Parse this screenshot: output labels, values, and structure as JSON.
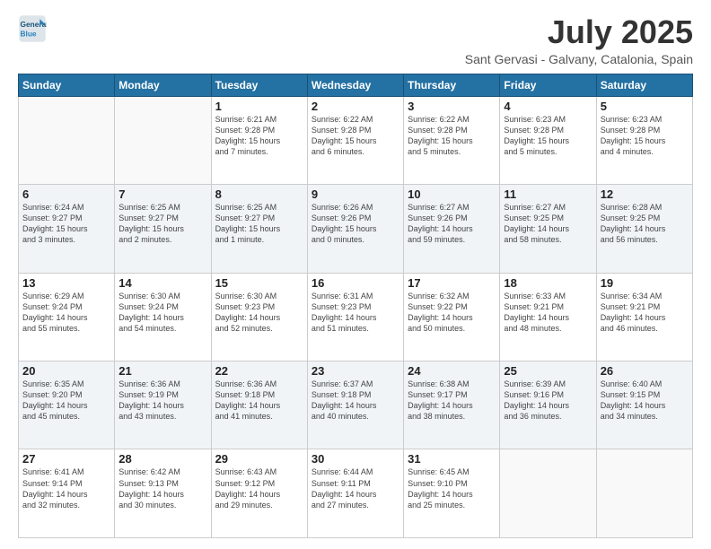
{
  "header": {
    "logo_line1": "General",
    "logo_line2": "Blue",
    "month_title": "July 2025",
    "location": "Sant Gervasi - Galvany, Catalonia, Spain"
  },
  "days_of_week": [
    "Sunday",
    "Monday",
    "Tuesday",
    "Wednesday",
    "Thursday",
    "Friday",
    "Saturday"
  ],
  "weeks": [
    [
      {
        "day": "",
        "info": ""
      },
      {
        "day": "",
        "info": ""
      },
      {
        "day": "1",
        "info": "Sunrise: 6:21 AM\nSunset: 9:28 PM\nDaylight: 15 hours\nand 7 minutes."
      },
      {
        "day": "2",
        "info": "Sunrise: 6:22 AM\nSunset: 9:28 PM\nDaylight: 15 hours\nand 6 minutes."
      },
      {
        "day": "3",
        "info": "Sunrise: 6:22 AM\nSunset: 9:28 PM\nDaylight: 15 hours\nand 5 minutes."
      },
      {
        "day": "4",
        "info": "Sunrise: 6:23 AM\nSunset: 9:28 PM\nDaylight: 15 hours\nand 5 minutes."
      },
      {
        "day": "5",
        "info": "Sunrise: 6:23 AM\nSunset: 9:28 PM\nDaylight: 15 hours\nand 4 minutes."
      }
    ],
    [
      {
        "day": "6",
        "info": "Sunrise: 6:24 AM\nSunset: 9:27 PM\nDaylight: 15 hours\nand 3 minutes."
      },
      {
        "day": "7",
        "info": "Sunrise: 6:25 AM\nSunset: 9:27 PM\nDaylight: 15 hours\nand 2 minutes."
      },
      {
        "day": "8",
        "info": "Sunrise: 6:25 AM\nSunset: 9:27 PM\nDaylight: 15 hours\nand 1 minute."
      },
      {
        "day": "9",
        "info": "Sunrise: 6:26 AM\nSunset: 9:26 PM\nDaylight: 15 hours\nand 0 minutes."
      },
      {
        "day": "10",
        "info": "Sunrise: 6:27 AM\nSunset: 9:26 PM\nDaylight: 14 hours\nand 59 minutes."
      },
      {
        "day": "11",
        "info": "Sunrise: 6:27 AM\nSunset: 9:25 PM\nDaylight: 14 hours\nand 58 minutes."
      },
      {
        "day": "12",
        "info": "Sunrise: 6:28 AM\nSunset: 9:25 PM\nDaylight: 14 hours\nand 56 minutes."
      }
    ],
    [
      {
        "day": "13",
        "info": "Sunrise: 6:29 AM\nSunset: 9:24 PM\nDaylight: 14 hours\nand 55 minutes."
      },
      {
        "day": "14",
        "info": "Sunrise: 6:30 AM\nSunset: 9:24 PM\nDaylight: 14 hours\nand 54 minutes."
      },
      {
        "day": "15",
        "info": "Sunrise: 6:30 AM\nSunset: 9:23 PM\nDaylight: 14 hours\nand 52 minutes."
      },
      {
        "day": "16",
        "info": "Sunrise: 6:31 AM\nSunset: 9:23 PM\nDaylight: 14 hours\nand 51 minutes."
      },
      {
        "day": "17",
        "info": "Sunrise: 6:32 AM\nSunset: 9:22 PM\nDaylight: 14 hours\nand 50 minutes."
      },
      {
        "day": "18",
        "info": "Sunrise: 6:33 AM\nSunset: 9:21 PM\nDaylight: 14 hours\nand 48 minutes."
      },
      {
        "day": "19",
        "info": "Sunrise: 6:34 AM\nSunset: 9:21 PM\nDaylight: 14 hours\nand 46 minutes."
      }
    ],
    [
      {
        "day": "20",
        "info": "Sunrise: 6:35 AM\nSunset: 9:20 PM\nDaylight: 14 hours\nand 45 minutes."
      },
      {
        "day": "21",
        "info": "Sunrise: 6:36 AM\nSunset: 9:19 PM\nDaylight: 14 hours\nand 43 minutes."
      },
      {
        "day": "22",
        "info": "Sunrise: 6:36 AM\nSunset: 9:18 PM\nDaylight: 14 hours\nand 41 minutes."
      },
      {
        "day": "23",
        "info": "Sunrise: 6:37 AM\nSunset: 9:18 PM\nDaylight: 14 hours\nand 40 minutes."
      },
      {
        "day": "24",
        "info": "Sunrise: 6:38 AM\nSunset: 9:17 PM\nDaylight: 14 hours\nand 38 minutes."
      },
      {
        "day": "25",
        "info": "Sunrise: 6:39 AM\nSunset: 9:16 PM\nDaylight: 14 hours\nand 36 minutes."
      },
      {
        "day": "26",
        "info": "Sunrise: 6:40 AM\nSunset: 9:15 PM\nDaylight: 14 hours\nand 34 minutes."
      }
    ],
    [
      {
        "day": "27",
        "info": "Sunrise: 6:41 AM\nSunset: 9:14 PM\nDaylight: 14 hours\nand 32 minutes."
      },
      {
        "day": "28",
        "info": "Sunrise: 6:42 AM\nSunset: 9:13 PM\nDaylight: 14 hours\nand 30 minutes."
      },
      {
        "day": "29",
        "info": "Sunrise: 6:43 AM\nSunset: 9:12 PM\nDaylight: 14 hours\nand 29 minutes."
      },
      {
        "day": "30",
        "info": "Sunrise: 6:44 AM\nSunset: 9:11 PM\nDaylight: 14 hours\nand 27 minutes."
      },
      {
        "day": "31",
        "info": "Sunrise: 6:45 AM\nSunset: 9:10 PM\nDaylight: 14 hours\nand 25 minutes."
      },
      {
        "day": "",
        "info": ""
      },
      {
        "day": "",
        "info": ""
      }
    ]
  ]
}
